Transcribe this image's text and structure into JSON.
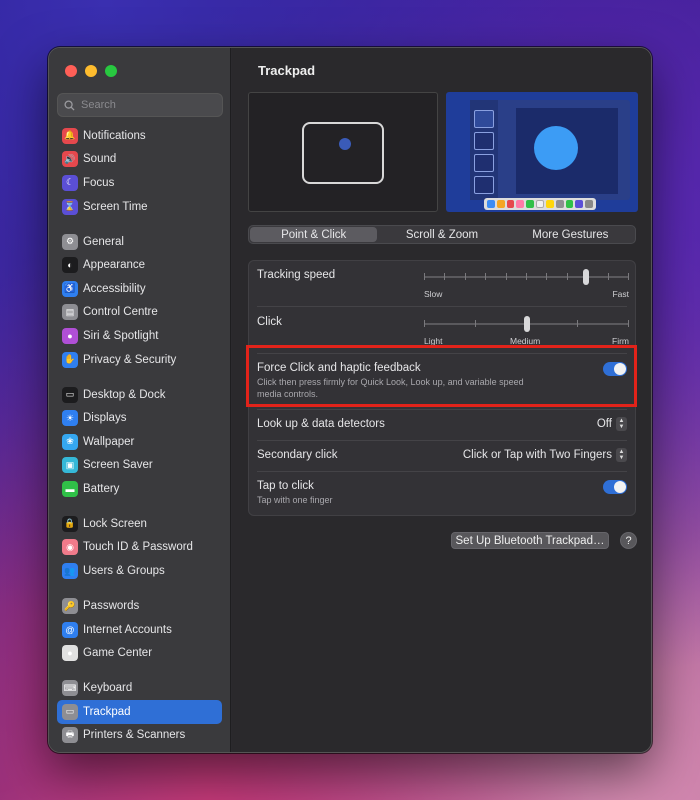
{
  "window": {
    "title": "Trackpad"
  },
  "search": {
    "placeholder": "Search"
  },
  "sidebar": {
    "groups": [
      [
        {
          "label": "Notifications",
          "icon": "bell-icon",
          "color": "#e5484d",
          "glyph": "🔔"
        },
        {
          "label": "Sound",
          "icon": "speaker-icon",
          "color": "#e5484d",
          "glyph": "🔊"
        },
        {
          "label": "Focus",
          "icon": "moon-icon",
          "color": "#5b4fd6",
          "glyph": "☾"
        },
        {
          "label": "Screen Time",
          "icon": "hourglass-icon",
          "color": "#5b4fd6",
          "glyph": "⌛"
        }
      ],
      [
        {
          "label": "General",
          "icon": "gear-icon",
          "color": "#8e8e93",
          "glyph": "⚙"
        },
        {
          "label": "Appearance",
          "icon": "appearance-icon",
          "color": "#1c1c1e",
          "glyph": "◐"
        },
        {
          "label": "Accessibility",
          "icon": "accessibility-icon",
          "color": "#2f7ff0",
          "glyph": "♿"
        },
        {
          "label": "Control Centre",
          "icon": "control-centre-icon",
          "color": "#8e8e93",
          "glyph": "▤"
        },
        {
          "label": "Siri & Spotlight",
          "icon": "siri-icon",
          "color": "#b04fd6",
          "glyph": "●"
        },
        {
          "label": "Privacy & Security",
          "icon": "hand-icon",
          "color": "#2f7ff0",
          "glyph": "✋"
        }
      ],
      [
        {
          "label": "Desktop & Dock",
          "icon": "dock-icon",
          "color": "#1c1c1e",
          "glyph": "▭"
        },
        {
          "label": "Displays",
          "icon": "sun-icon",
          "color": "#2f7ff0",
          "glyph": "☀"
        },
        {
          "label": "Wallpaper",
          "icon": "flower-icon",
          "color": "#35a7f0",
          "glyph": "❀"
        },
        {
          "label": "Screen Saver",
          "icon": "screen-saver-icon",
          "color": "#35b8d8",
          "glyph": "▣"
        },
        {
          "label": "Battery",
          "icon": "battery-icon",
          "color": "#30c048",
          "glyph": "▬"
        }
      ],
      [
        {
          "label": "Lock Screen",
          "icon": "lock-icon",
          "color": "#1c1c1e",
          "glyph": "🔒"
        },
        {
          "label": "Touch ID & Password",
          "icon": "fingerprint-icon",
          "color": "#f07a8a",
          "glyph": "◉"
        },
        {
          "label": "Users & Groups",
          "icon": "users-icon",
          "color": "#2f7ff0",
          "glyph": "👥"
        }
      ],
      [
        {
          "label": "Passwords",
          "icon": "key-icon",
          "color": "#8e8e93",
          "glyph": "🔑"
        },
        {
          "label": "Internet Accounts",
          "icon": "at-icon",
          "color": "#2f7ff0",
          "glyph": "@"
        },
        {
          "label": "Game Center",
          "icon": "game-center-icon",
          "color": "#e0e0e0",
          "glyph": "●"
        }
      ],
      [
        {
          "label": "Keyboard",
          "icon": "keyboard-icon",
          "color": "#8e8e93",
          "glyph": "⌨"
        },
        {
          "label": "Trackpad",
          "icon": "trackpad-icon",
          "color": "#8e8e93",
          "glyph": "▭",
          "active": true
        },
        {
          "label": "Printers & Scanners",
          "icon": "printer-icon",
          "color": "#8e8e93",
          "glyph": "🖶"
        }
      ]
    ]
  },
  "tabs": [
    "Point & Click",
    "Scroll & Zoom",
    "More Gestures"
  ],
  "settings": {
    "tracking_speed": {
      "label": "Tracking speed",
      "min_label": "Slow",
      "max_label": "Fast",
      "value": 0.8
    },
    "click": {
      "label": "Click",
      "labels": [
        "Light",
        "Medium",
        "Firm"
      ],
      "value": 0.5
    },
    "force_click": {
      "label": "Force Click and haptic feedback",
      "description_line1": "Click then press firmly for Quick Look, Look up, and variable speed",
      "description_line2": "media controls.",
      "enabled": true
    },
    "lookup": {
      "label": "Look up & data detectors",
      "value": "Off"
    },
    "secondary_click": {
      "label": "Secondary click",
      "value": "Click or Tap with Two Fingers"
    },
    "tap_to_click": {
      "label": "Tap to click",
      "description": "Tap with one finger",
      "enabled": true
    }
  },
  "buttons": {
    "setup_bluetooth": "Set Up Bluetooth Trackpad…",
    "help": "?"
  }
}
